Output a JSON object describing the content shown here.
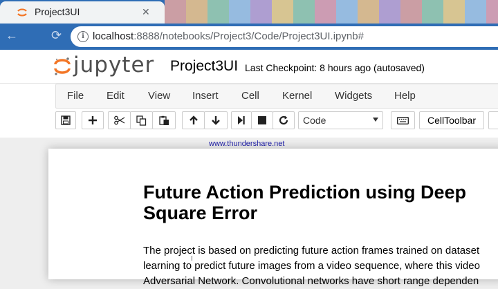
{
  "browser": {
    "tab_title": "Project3UI",
    "close_glyph": "✕",
    "url_host": "localhost",
    "url_rest": ":8888/notebooks/Project3/Code/Project3UI.ipynb#",
    "back_glyph": "←",
    "reload_glyph": "⟳",
    "info_glyph": "i",
    "stripe_colors": [
      "#e6a7a1",
      "#f1c58a",
      "#9fd0b0",
      "#a8c9e8",
      "#c4a7d6",
      "#f4d58c",
      "#9fd0b0",
      "#e8a5b3",
      "#a8c9e8",
      "#f1c58a",
      "#c4a7d6",
      "#e6a7a1",
      "#9fd0b0",
      "#f4d58c",
      "#a8c9e8",
      "#e8a5b3"
    ]
  },
  "jupyter": {
    "logo_text": "jupyter",
    "notebook_name": "Project3UI",
    "checkpoint": "Last Checkpoint: 8 hours ago (autosaved)",
    "brand_color": "#f37626"
  },
  "menu": {
    "items": [
      "File",
      "Edit",
      "View",
      "Insert",
      "Cell",
      "Kernel",
      "Widgets",
      "Help"
    ]
  },
  "toolbar": {
    "icons": [
      "save-icon",
      "plus-icon",
      "cut-icon",
      "copy-icon",
      "paste-icon",
      "arrow-up-icon",
      "arrow-down-icon",
      "step-forward-icon",
      "stop-icon",
      "restart-icon",
      "keyboard-icon"
    ],
    "cell_type": "Code",
    "celltoolbar_label": "CellToolbar"
  },
  "watermark": "www.thundershare.net",
  "notebook": {
    "title_line1": "Future Action Prediction using Deep",
    "title_line2": "Square Error",
    "para_line1": "The project is based on predicting future action frames trained on dataset",
    "para_line2": "learning to predict future images from a video sequence, where this video",
    "para_line3": "Adversarial Network. Convolutional networks have short range dependen"
  }
}
